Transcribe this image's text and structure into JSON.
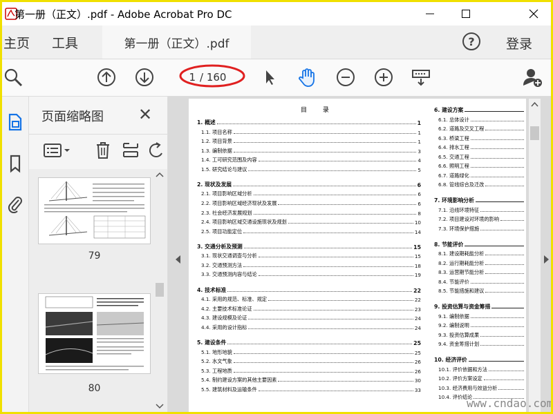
{
  "window": {
    "title": "第一册（正文）.pdf - Adobe Acrobat Pro DC",
    "controls": {
      "minimize": "—",
      "maximize": "☐",
      "close": "✕"
    }
  },
  "tabs": {
    "home": "主页",
    "tools": "工具",
    "document": "第一册（正文）.pdf",
    "help": "?",
    "login": "登录"
  },
  "toolbar": {
    "icons": [
      "search-zoom-icon",
      "previous-page-icon",
      "next-page-icon",
      "select-arrow-icon",
      "hand-tool-icon",
      "zoom-out-icon",
      "zoom-in-icon",
      "page-display-icon",
      "share-user-icon"
    ],
    "current_page": "1",
    "page_total": "/ 160"
  },
  "rail": {
    "icons": [
      "page-thumbnails-icon",
      "bookmark-icon",
      "attachment-icon"
    ]
  },
  "panel": {
    "title": "页面缩略图",
    "close": "✕",
    "thumbnails": [
      {
        "label": "79"
      },
      {
        "label": "80"
      }
    ]
  },
  "document": {
    "toc_heading": "目 录",
    "left_column": [
      {
        "text": "1. 概述",
        "page": "1",
        "heading": true
      },
      {
        "text": "1.1. 项目名称",
        "page": "1"
      },
      {
        "text": "1.2. 项目背景",
        "page": "1"
      },
      {
        "text": "1.3. 编制依据",
        "page": "3"
      },
      {
        "text": "1.4. 工可研究范围及内容",
        "page": "4"
      },
      {
        "text": "1.5. 研究结论与建议",
        "page": "5"
      },
      {
        "text": "2. 现状及发展",
        "page": "6",
        "heading": true
      },
      {
        "text": "2.1. 项目影响区域分析",
        "page": "6"
      },
      {
        "text": "2.2. 项目影响区域经济现状及发展",
        "page": "6"
      },
      {
        "text": "2.3. 社会经济发展规划",
        "page": "8"
      },
      {
        "text": "2.4. 项目影响区域交通设施现状及规划",
        "page": "10"
      },
      {
        "text": "2.5. 项目功能定位",
        "page": "14"
      },
      {
        "text": "3. 交通分析及预测",
        "page": "15",
        "heading": true
      },
      {
        "text": "3.1. 现状交通调查与分析",
        "page": "15"
      },
      {
        "text": "3.2. 交通预测方法",
        "page": "18"
      },
      {
        "text": "3.3. 交通预测内容与结论",
        "page": "19"
      },
      {
        "text": "4. 技术标准",
        "page": "22",
        "heading": true
      },
      {
        "text": "4.1. 采用的规范、标准、规定",
        "page": "22"
      },
      {
        "text": "4.2. 主要技术标准论证",
        "page": "23"
      },
      {
        "text": "4.3. 建设规模及论证",
        "page": "24"
      },
      {
        "text": "4.4. 采用的设计指标",
        "page": "24"
      },
      {
        "text": "5. 建设条件",
        "page": "25",
        "heading": true
      },
      {
        "text": "5.1. 地形地貌",
        "page": "25"
      },
      {
        "text": "5.2. 水文气象",
        "page": "26"
      },
      {
        "text": "5.3. 工程地质",
        "page": "26"
      },
      {
        "text": "5.4. 制约建设方案的其他主要因素",
        "page": "30"
      },
      {
        "text": "5.5. 建筑材料及运输条件",
        "page": "33"
      }
    ],
    "right_column": [
      {
        "text": "6. 建设方案",
        "heading": true
      },
      {
        "text": "6.1. 总体设计"
      },
      {
        "text": "6.2. 道路及交叉工程"
      },
      {
        "text": "6.3. 桥梁工程"
      },
      {
        "text": "6.4. 排水工程"
      },
      {
        "text": "6.5. 交通工程"
      },
      {
        "text": "6.6. 照明工程"
      },
      {
        "text": "6.7. 道路绿化"
      },
      {
        "text": "6.8. 管线综合及迁改"
      },
      {
        "text": "7. 环境影响分析",
        "heading": true
      },
      {
        "text": "7.1. 沿线环境特征"
      },
      {
        "text": "7.2. 项目建设对环境的影响"
      },
      {
        "text": "7.3. 环境保护措施"
      },
      {
        "text": "8. 节能评价",
        "heading": true
      },
      {
        "text": "8.1. 建设期耗能分析"
      },
      {
        "text": "8.2. 运行期耗能分析"
      },
      {
        "text": "8.3. 运营期节能分析"
      },
      {
        "text": "8.4. 节能评价"
      },
      {
        "text": "8.5. 节能措施和建议"
      },
      {
        "text": "9. 投资估算与资金筹措",
        "heading": true
      },
      {
        "text": "9.1. 编制依据"
      },
      {
        "text": "9.2. 编制说明"
      },
      {
        "text": "9.3. 投资估算成果"
      },
      {
        "text": "9.4. 资金筹措计划"
      },
      {
        "text": "10. 经济评价",
        "heading": true
      },
      {
        "text": "10.1. 评价依据和方法"
      },
      {
        "text": "10.2. 评价方案设定"
      },
      {
        "text": "10.3. 经济费用与效益分析"
      },
      {
        "text": "10.4. 评价结论"
      }
    ]
  },
  "watermark": "www.cndao.com",
  "colors": {
    "frame": "#f0e000",
    "accent": "#1473e6",
    "highlight_ellipse": "#e02020"
  }
}
